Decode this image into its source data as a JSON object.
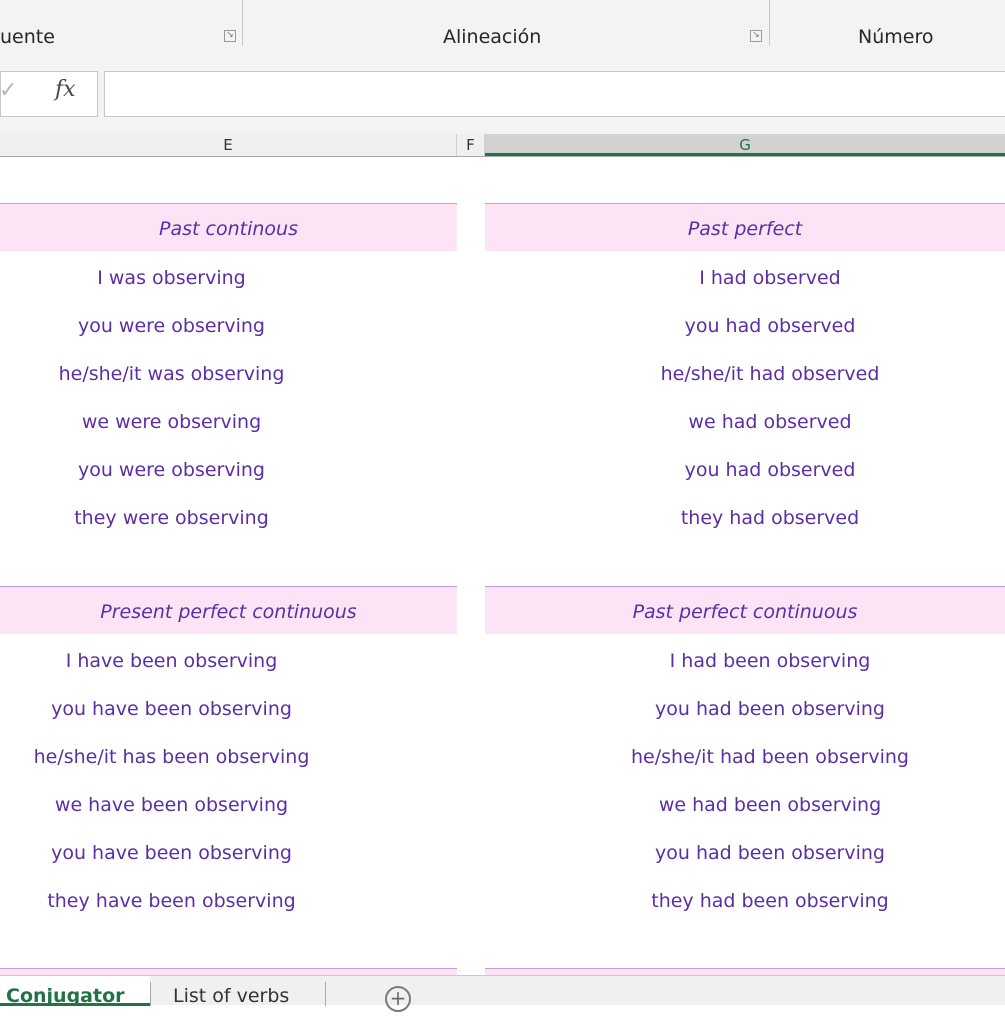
{
  "ribbon": {
    "groups": [
      {
        "label": "uente"
      },
      {
        "label": "Alineación"
      },
      {
        "label": "Número"
      }
    ]
  },
  "formula_bar": {
    "fx_label": "fx",
    "value": ""
  },
  "columns": [
    "E",
    "F",
    "G"
  ],
  "sections": [
    {
      "title": "Past continous",
      "rows": [
        "I was observing",
        "you were observing",
        "he/she/it was observing",
        "we were observing",
        "you were observing",
        "they were observing"
      ]
    },
    {
      "title": "Past perfect",
      "rows": [
        "I had observed",
        "you had observed",
        "he/she/it had observed",
        "we had observed",
        "you had observed",
        "they had observed"
      ]
    },
    {
      "title": "Present perfect continuous",
      "rows": [
        "I have been observing",
        "you have been observing",
        "he/she/it has been observing",
        "we have been observing",
        "you have been observing",
        "they have been observing"
      ]
    },
    {
      "title": "Past perfect continuous",
      "rows": [
        "I had been observing",
        "you had been observing",
        "he/she/it had been observing",
        "we had been observing",
        "you had been observing",
        "they had been observing"
      ]
    }
  ],
  "sheet_tabs": [
    {
      "label": "Conjugator",
      "active": true
    },
    {
      "label": "List of verbs",
      "active": false
    }
  ]
}
